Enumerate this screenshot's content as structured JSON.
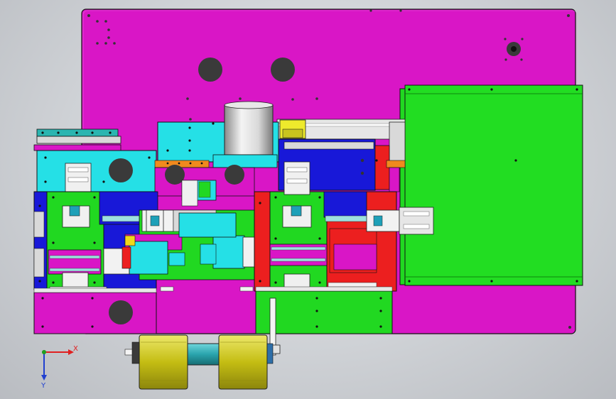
{
  "viewport": {
    "axis_x_label": "X",
    "axis_y_label": "Y",
    "axis_x_color": "#e02020",
    "axis_y_color": "#2040d0",
    "axis_z_color": "#20a020"
  },
  "colors": {
    "base_plate": "#d916c6",
    "green": "#21d821",
    "cyan": "#25e0e6",
    "blue": "#1818d8",
    "red": "#ec1f1f",
    "yellow": "#c9c316",
    "teal": "#2fa8b0",
    "grey": "#d4d4d4",
    "dark": "#2a2a2a"
  }
}
